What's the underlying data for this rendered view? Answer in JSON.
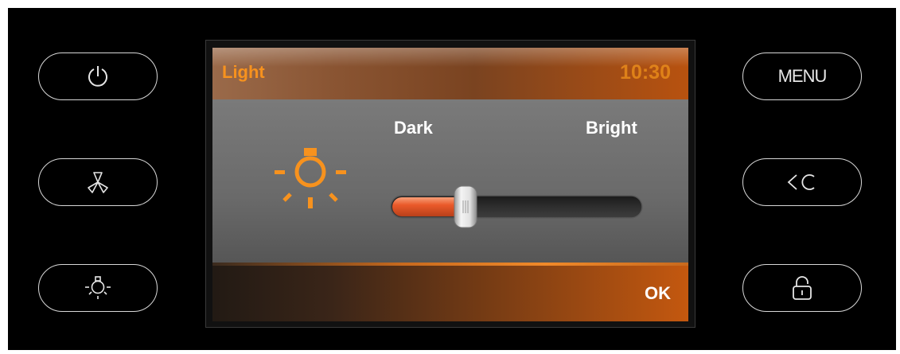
{
  "screen": {
    "title": "Light",
    "clock": "10:30",
    "slider": {
      "min_label": "Dark",
      "max_label": "Bright",
      "value": 0.25
    },
    "ok_label": "OK"
  },
  "left_buttons": [
    {
      "icon": "power-icon"
    },
    {
      "icon": "fan-icon"
    },
    {
      "icon": "light-bulb-icon"
    }
  ],
  "right_buttons": [
    {
      "label": "MENU"
    },
    {
      "icon": "back-icon"
    },
    {
      "icon": "lock-icon"
    }
  ],
  "colors": {
    "accent": "#f7921e",
    "slider_fill": "#e85a2a",
    "panel": "#000000"
  }
}
